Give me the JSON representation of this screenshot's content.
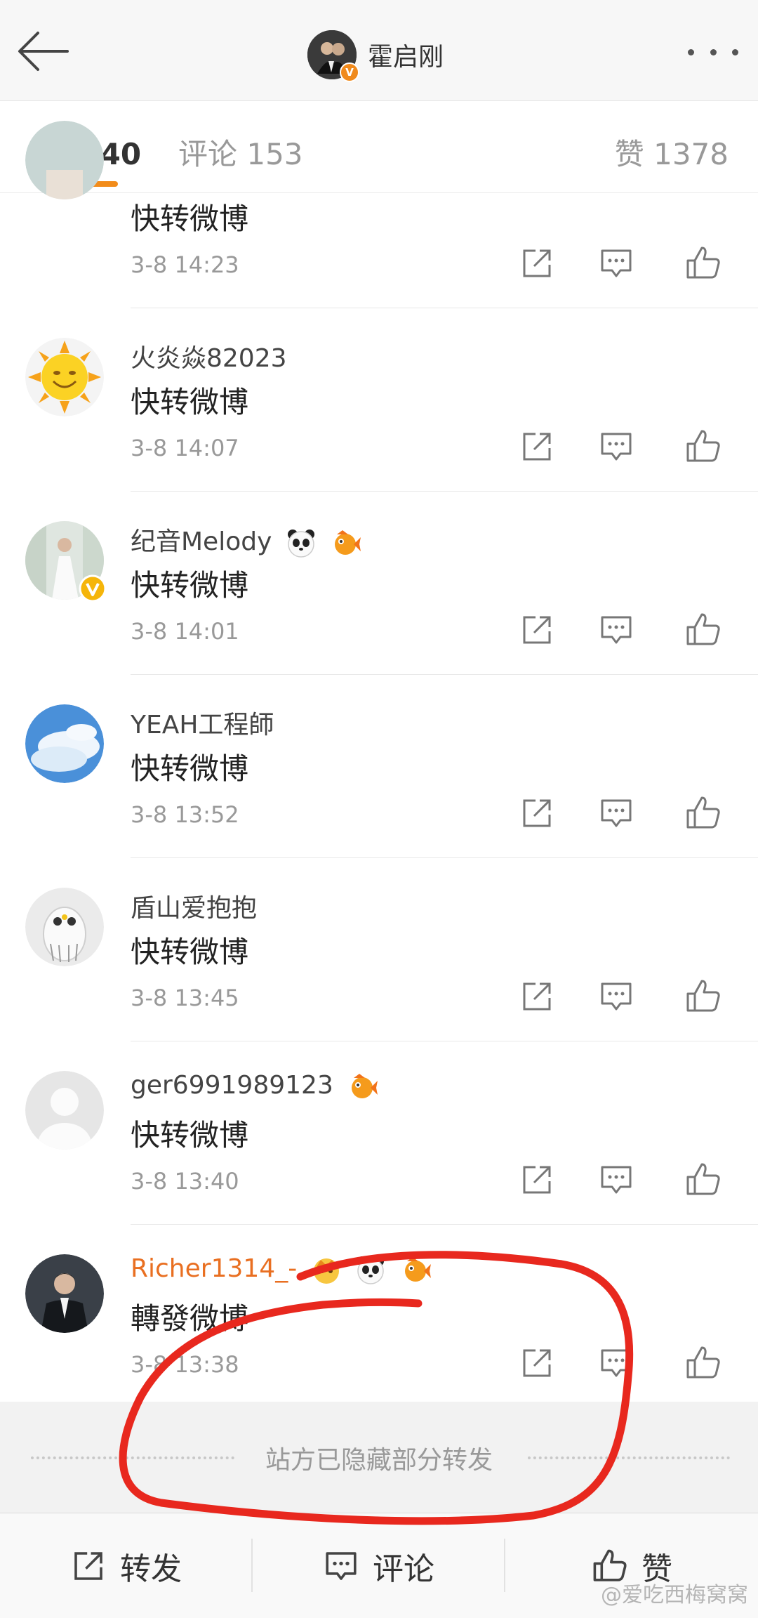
{
  "header": {
    "title": "霍启刚",
    "avatar_badge": "V"
  },
  "tabs": [
    {
      "label": "转发 40",
      "active": true
    },
    {
      "label": "评论 153",
      "active": false
    },
    {
      "label": "赞 1378",
      "active": false
    }
  ],
  "reposts": [
    {
      "name": "",
      "content": "快转微博",
      "time": "3-8 14:23",
      "avatar": "partial-avatar"
    },
    {
      "name": "火炎焱82023",
      "content": "快转微博",
      "time": "3-8 14:07",
      "avatar": "sun-avatar"
    },
    {
      "name": "纪音Melody",
      "content": "快转微博",
      "time": "3-8 14:01",
      "avatar": "wedding-photo-avatar",
      "verified": true,
      "emojis": [
        "panda-icon",
        "fish-icon"
      ]
    },
    {
      "name": "YEAH工程師",
      "content": "快转微博",
      "time": "3-8 13:52",
      "avatar": "sky-clouds-avatar"
    },
    {
      "name": "盾山爱抱抱",
      "content": "快转微博",
      "time": "3-8 13:45",
      "avatar": "owl-avatar"
    },
    {
      "name": "ger6991989123",
      "content": "快转微博",
      "time": "3-8 13:40",
      "avatar": "default-person-avatar",
      "emojis": [
        "fish-icon"
      ]
    },
    {
      "name": "Richer1314_-",
      "content": "轉發微博",
      "time": "3-8 13:38",
      "avatar": "man-in-suit-avatar",
      "name_color": "#e96f21",
      "emojis": [
        "crown-icon",
        "panda-icon",
        "fish-icon"
      ]
    }
  ],
  "hidden_notice": "站方已隐藏部分转发",
  "bottom_bar": {
    "repost_label": "转发",
    "comment_label": "评论",
    "like_label": "赞"
  },
  "watermark": "@爱吃西梅窝窝",
  "colors": {
    "accent_orange": "#f28c1a",
    "annotation_red": "#e8281e"
  }
}
